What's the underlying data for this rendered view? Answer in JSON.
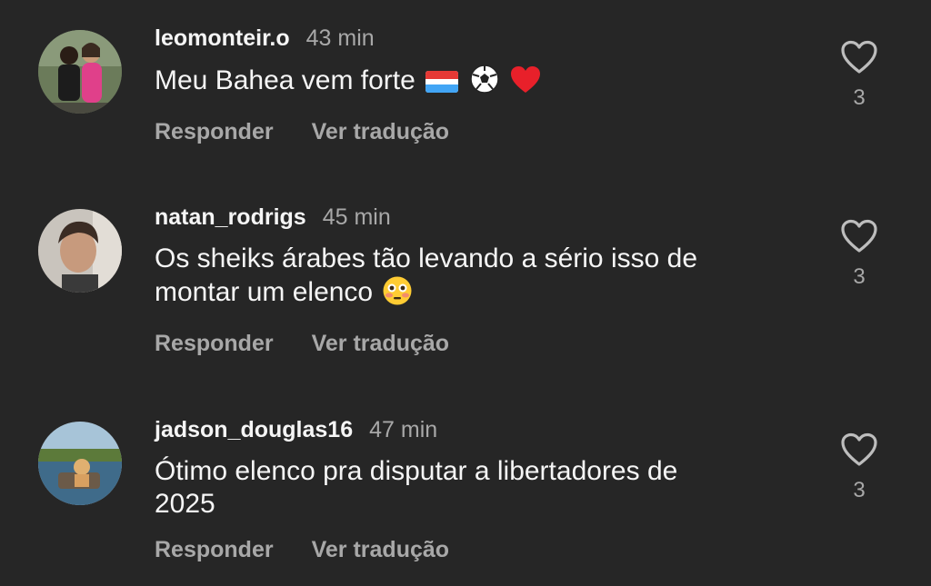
{
  "comments": [
    {
      "username": "leomonteir.o",
      "time": "43 min",
      "text": "Meu Bahea vem forte",
      "emojis": [
        "flag-icon",
        "soccer-ball-icon",
        "red-heart-icon"
      ],
      "reply_label": "Responder",
      "translate_label": "Ver tradução",
      "likes": "3"
    },
    {
      "username": "natan_rodrigs",
      "time": "45 min",
      "text": "Os sheiks árabes tão levando a sério isso de montar um elenco",
      "emojis": [
        "flushed-face-icon"
      ],
      "reply_label": "Responder",
      "translate_label": "Ver tradução",
      "likes": "3"
    },
    {
      "username": "jadson_douglas16",
      "time": "47 min",
      "text": "Ótimo elenco pra disputar a libertadores de 2025",
      "emojis": [],
      "reply_label": "Responder",
      "translate_label": "Ver tradução",
      "likes": "3"
    }
  ]
}
